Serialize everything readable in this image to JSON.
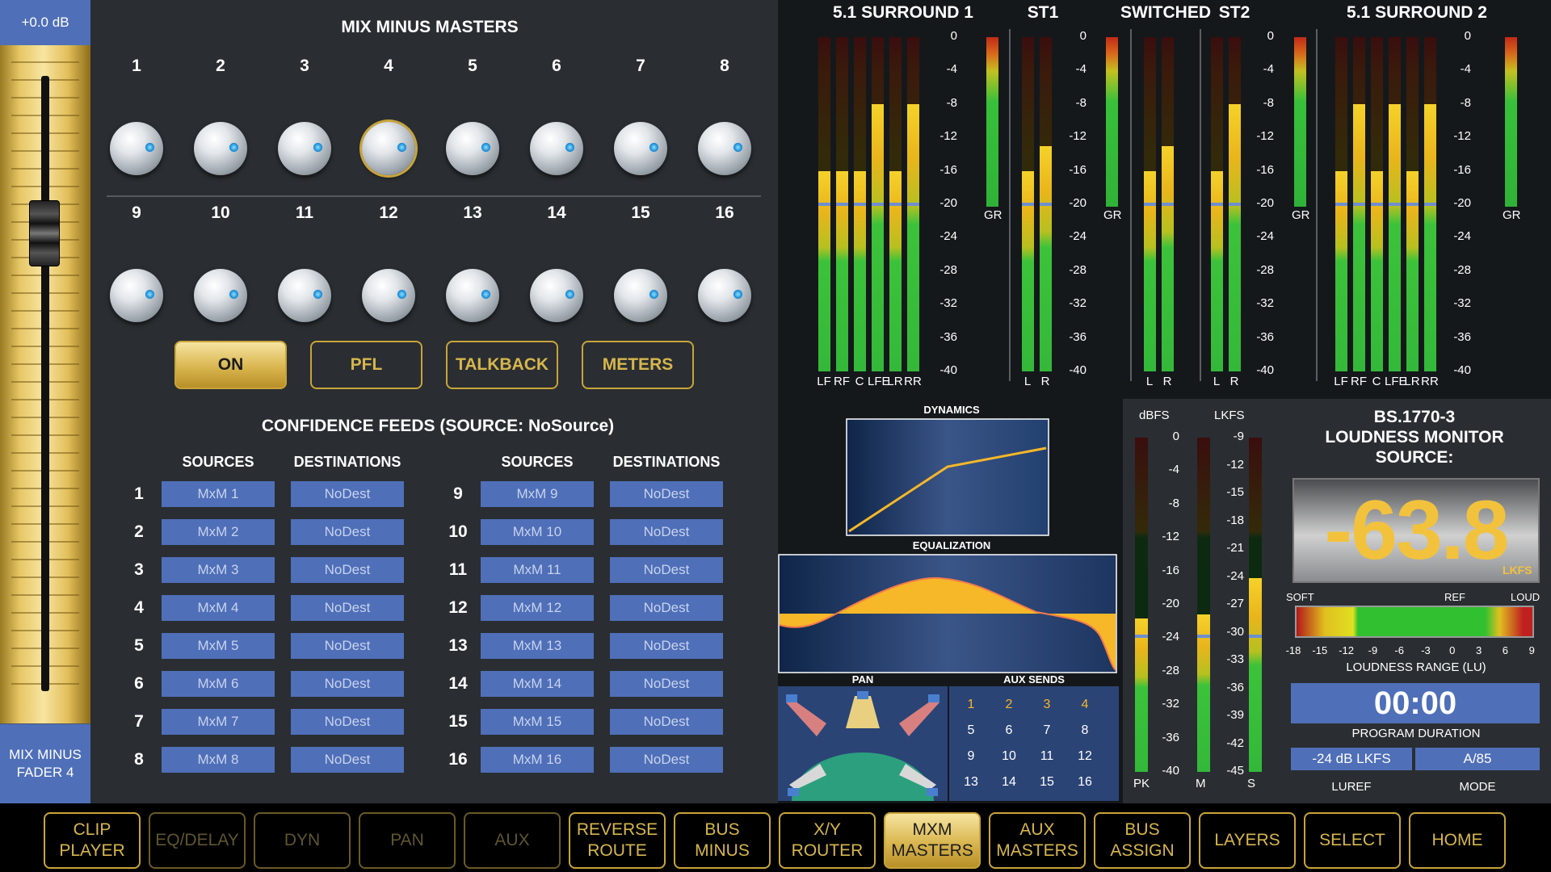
{
  "fader": {
    "value": "+0.0 dB",
    "name_line1": "MIX MINUS",
    "name_line2": "FADER 4"
  },
  "mxm": {
    "title": "MIX MINUS MASTERS",
    "knobs_row1": [
      "1",
      "2",
      "3",
      "4",
      "5",
      "6",
      "7",
      "8"
    ],
    "knobs_row2": [
      "9",
      "10",
      "11",
      "12",
      "13",
      "14",
      "15",
      "16"
    ],
    "selected_knob": "4",
    "buttons": [
      "ON",
      "PFL",
      "TALKBACK",
      "METERS"
    ],
    "active_button": "ON"
  },
  "confidence": {
    "title": "CONFIDENCE FEEDS (SOURCE: NoSource)",
    "col_sources": "SOURCES",
    "col_destinations": "DESTINATIONS",
    "rows": [
      {
        "n": "1",
        "src": "MxM 1",
        "dst": "NoDest"
      },
      {
        "n": "2",
        "src": "MxM 2",
        "dst": "NoDest"
      },
      {
        "n": "3",
        "src": "MxM 3",
        "dst": "NoDest"
      },
      {
        "n": "4",
        "src": "MxM 4",
        "dst": "NoDest"
      },
      {
        "n": "5",
        "src": "MxM 5",
        "dst": "NoDest"
      },
      {
        "n": "6",
        "src": "MxM 6",
        "dst": "NoDest"
      },
      {
        "n": "7",
        "src": "MxM 7",
        "dst": "NoDest"
      },
      {
        "n": "8",
        "src": "MxM 8",
        "dst": "NoDest"
      },
      {
        "n": "9",
        "src": "MxM 9",
        "dst": "NoDest"
      },
      {
        "n": "10",
        "src": "MxM 10",
        "dst": "NoDest"
      },
      {
        "n": "11",
        "src": "MxM 11",
        "dst": "NoDest"
      },
      {
        "n": "12",
        "src": "MxM 12",
        "dst": "NoDest"
      },
      {
        "n": "13",
        "src": "MxM 13",
        "dst": "NoDest"
      },
      {
        "n": "14",
        "src": "MxM 14",
        "dst": "NoDest"
      },
      {
        "n": "15",
        "src": "MxM 15",
        "dst": "NoDest"
      },
      {
        "n": "16",
        "src": "MxM 16",
        "dst": "NoDest"
      }
    ]
  },
  "meters": {
    "groups": [
      "5.1 SURROUND 1",
      "ST1",
      "SWITCHED",
      "ST2",
      "5.1 SURROUND 2"
    ],
    "scale": [
      "0",
      "-4",
      "-8",
      "-12",
      "-16",
      "-20",
      "-24",
      "-28",
      "-32",
      "-36",
      "-40"
    ],
    "gr_label": "GR",
    "surround_channels": [
      "LF",
      "RF",
      "C",
      "LFE",
      "LR",
      "RR"
    ],
    "stereo_channels": [
      "L",
      "R"
    ],
    "levels_dbfs": {
      "surround1": [
        -16,
        -16,
        -16,
        -8,
        -16,
        -8
      ],
      "st1": [
        -16,
        -13
      ],
      "switched": [
        -16,
        -13
      ],
      "st2": [
        -16,
        -8
      ],
      "surround2": [
        -16,
        -8,
        -16,
        -8,
        -16,
        -8
      ]
    }
  },
  "processing": {
    "dynamics_label": "DYNAMICS",
    "eq_label": "EQUALIZATION",
    "pan_label": "PAN",
    "aux_label": "AUX SENDS",
    "aux_numbers": [
      "1",
      "2",
      "3",
      "4",
      "5",
      "6",
      "7",
      "8",
      "9",
      "10",
      "11",
      "12",
      "13",
      "14",
      "15",
      "16"
    ],
    "aux_highlight": [
      "1",
      "2",
      "3",
      "4"
    ]
  },
  "loudness": {
    "dbfs_label": "dBFS",
    "lkfs_label": "LKFS",
    "dbfs_scale": [
      "0",
      "-4",
      "-8",
      "-12",
      "-16",
      "-20",
      "-24",
      "-28",
      "-32",
      "-36",
      "-40"
    ],
    "lkfs_scale": [
      "-9",
      "-12",
      "-15",
      "-18",
      "-21",
      "-24",
      "-27",
      "-30",
      "-33",
      "-36",
      "-39",
      "-42",
      "-45"
    ],
    "bar_labels": [
      "PK",
      "M",
      "S"
    ],
    "title_line1": "BS.1770-3",
    "title_line2": "LOUDNESS MONITOR",
    "title_line3": "SOURCE:",
    "value": "-63.8",
    "value_unit": "LKFS",
    "range_soft": "SOFT",
    "range_ref": "REF",
    "range_loud": "LOUD",
    "range_ticks": [
      "-18",
      "-15",
      "-12",
      "-9",
      "-6",
      "-3",
      "0",
      "3",
      "6",
      "9"
    ],
    "range_label": "LOUDNESS RANGE (LU)",
    "duration": "00:00",
    "duration_label": "PROGRAM DURATION",
    "luref_value": "-24 dB LKFS",
    "mode_value": "A/85",
    "luref_label": "LUREF",
    "mode_label": "MODE"
  },
  "nav": {
    "buttons": [
      {
        "line1": "CLIP",
        "line2": "PLAYER",
        "state": "normal"
      },
      {
        "line1": "EQ/DELAY",
        "line2": "",
        "state": "dim"
      },
      {
        "line1": "DYN",
        "line2": "",
        "state": "dim"
      },
      {
        "line1": "PAN",
        "line2": "",
        "state": "dim"
      },
      {
        "line1": "AUX",
        "line2": "",
        "state": "dim"
      },
      {
        "line1": "REVERSE",
        "line2": "ROUTE",
        "state": "normal"
      },
      {
        "line1": "BUS",
        "line2": "MINUS",
        "state": "normal"
      },
      {
        "line1": "X/Y",
        "line2": "ROUTER",
        "state": "normal"
      },
      {
        "line1": "MXM",
        "line2": "MASTERS",
        "state": "active"
      },
      {
        "line1": "AUX",
        "line2": "MASTERS",
        "state": "normal"
      },
      {
        "line1": "BUS",
        "line2": "ASSIGN",
        "state": "normal"
      },
      {
        "line1": "LAYERS",
        "line2": "",
        "state": "normal"
      },
      {
        "line1": "SELECT",
        "line2": "",
        "state": "normal"
      },
      {
        "line1": "HOME",
        "line2": "",
        "state": "normal"
      }
    ]
  }
}
